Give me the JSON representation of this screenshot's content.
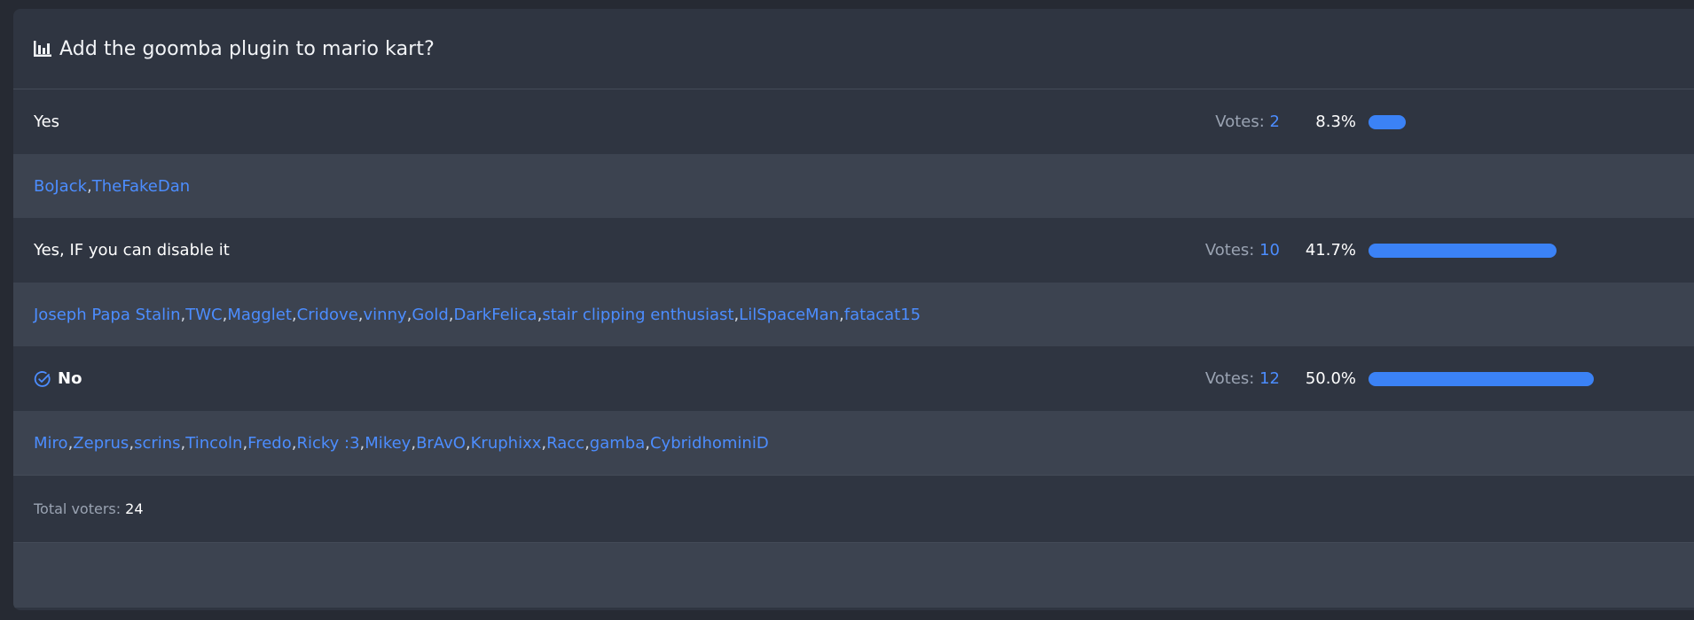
{
  "poll": {
    "title": "Add the goomba plugin to mario kart?",
    "accent_color": "#3b82f6",
    "link_color": "#4c8dff",
    "votes_label": "Votes:",
    "options": [
      {
        "label": "Yes",
        "votes": "2",
        "percent": "8.3%",
        "fraction": 0.083,
        "chosen": false,
        "voters": [
          "BoJack",
          "TheFakeDan"
        ]
      },
      {
        "label": "Yes, IF you can disable it",
        "votes": "10",
        "percent": "41.7%",
        "fraction": 0.417,
        "chosen": false,
        "voters": [
          "Joseph Papa Stalin",
          "TWC",
          "Magglet",
          "Cridove",
          "vinny",
          "Gold",
          "DarkFelica",
          "stair clipping enthusiast",
          "LilSpaceMan",
          "fatacat15"
        ]
      },
      {
        "label": "No",
        "votes": "12",
        "percent": "50.0%",
        "fraction": 0.5,
        "chosen": true,
        "voters": [
          "Miro",
          "Zeprus",
          "scrins",
          "Tincoln",
          "Fredo",
          "Ricky :3",
          "Mikey",
          "BrAvO",
          "Kruphixx",
          "Racc",
          "gamba",
          "CybridhominiD"
        ]
      }
    ],
    "total_label": "Total voters:",
    "total_voters": "24",
    "icons": {
      "header": "bar-chart-icon",
      "chosen": "check-circle-icon"
    }
  }
}
